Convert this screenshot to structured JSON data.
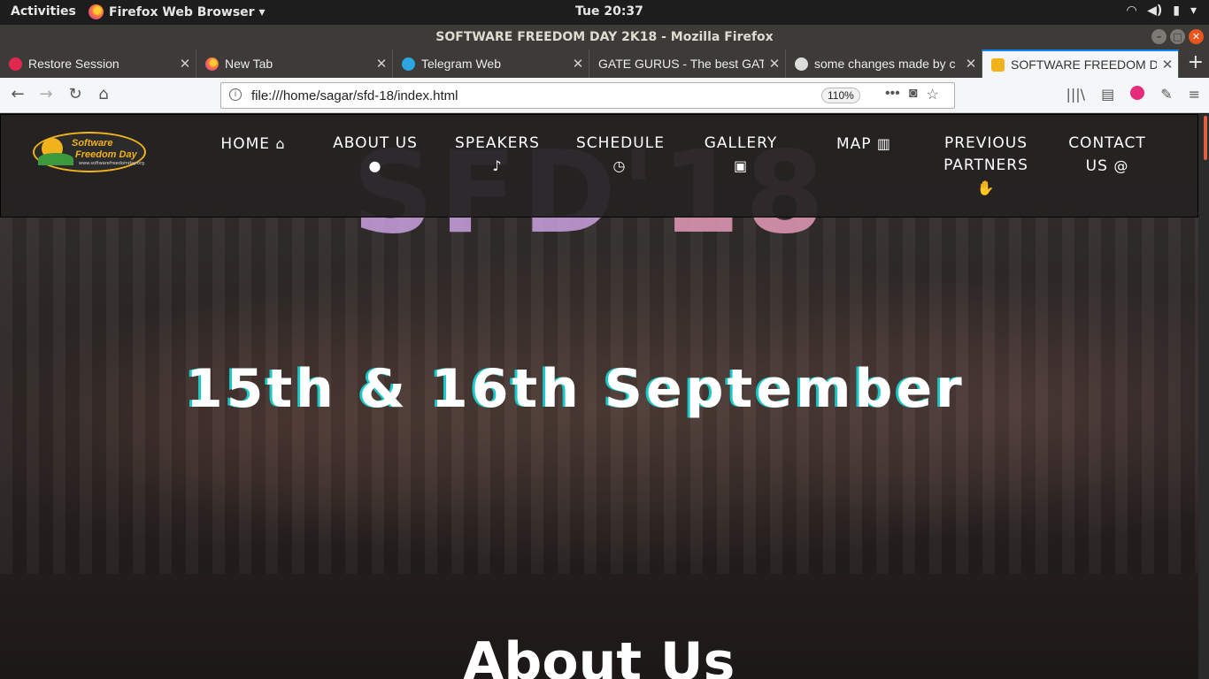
{
  "system": {
    "activities": "Activities",
    "app_menu": "Firefox Web Browser ▾",
    "clock": "Tue 20:37",
    "tray": [
      "wifi-icon",
      "volume-icon",
      "battery-icon",
      "power-icon"
    ]
  },
  "window": {
    "title": "SOFTWARE FREEDOM DAY 2K18 - Mozilla Firefox"
  },
  "tabs": [
    {
      "label": "Restore Session",
      "icon": "alert-icon",
      "color": "#e22850"
    },
    {
      "label": "New Tab",
      "icon": "firefox-icon",
      "color": "#ff7139"
    },
    {
      "label": "Telegram Web",
      "icon": "telegram-icon",
      "color": "#2ca5e0"
    },
    {
      "label": "GATE GURUS - The best GAT",
      "icon": "none",
      "color": "#3c3b37"
    },
    {
      "label": "some changes made by c",
      "icon": "github-icon",
      "color": "#dddddd"
    },
    {
      "label": "SOFTWARE FREEDOM DA",
      "icon": "sfd-icon",
      "color": "#f2b21b"
    }
  ],
  "navbar": {
    "url": "file:///home/sagar/sfd-18/index.html",
    "zoom": "110%"
  },
  "site": {
    "logo_line1": "Software",
    "logo_line2": "Freedom Day",
    "logo_line3": "www.softwarefreedomday.org",
    "menu": [
      {
        "label": "HOME",
        "icon": "home-icon"
      },
      {
        "label": "ABOUT US",
        "icon": "user-icon"
      },
      {
        "label": "SPEAKERS",
        "icon": "microphone-icon"
      },
      {
        "label": "SCHEDULE",
        "icon": "clock-icon"
      },
      {
        "label": "GALLERY",
        "icon": "image-icon"
      },
      {
        "label": "MAP",
        "icon": "map-icon"
      },
      {
        "label": "PREVIOUS PARTNERS",
        "icon": "handshake-icon"
      },
      {
        "label": "CONTACT US",
        "icon": "at-icon"
      }
    ],
    "hero_title_a": "SFD",
    "hero_title_b": "'18",
    "dates": "15th & 16th September",
    "about_heading": "About Us"
  }
}
